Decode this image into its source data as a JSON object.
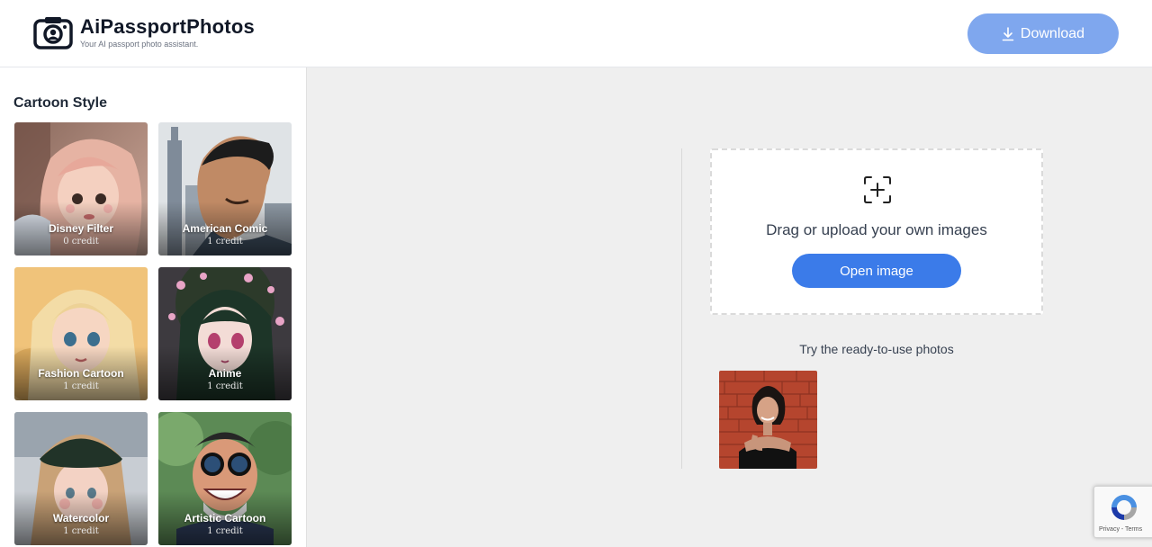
{
  "header": {
    "logo_name": "AiPassportPhotos",
    "logo_tagline": "Your AI passport photo assistant.",
    "download_label": "Download"
  },
  "sidebar": {
    "title": "Cartoon Style",
    "styles": [
      {
        "name": "Disney Filter",
        "credit": "0 credit"
      },
      {
        "name": "American Comic",
        "credit": "1 credit"
      },
      {
        "name": "Fashion Cartoon",
        "credit": "1 credit"
      },
      {
        "name": "Anime",
        "credit": "1 credit"
      },
      {
        "name": "Watercolor",
        "credit": "1 credit"
      },
      {
        "name": "Artistic Cartoon",
        "credit": "1 credit"
      }
    ]
  },
  "upload": {
    "prompt": "Drag or upload your own images",
    "open_label": "Open image",
    "icon": "image-add-icon"
  },
  "samples": {
    "title": "Try the ready-to-use photos"
  },
  "recaptcha": {
    "links": "Privacy - Terms"
  },
  "colors": {
    "download_button": "#7fa7ee",
    "open_button": "#3b7be9",
    "page_background": "#efefef"
  }
}
